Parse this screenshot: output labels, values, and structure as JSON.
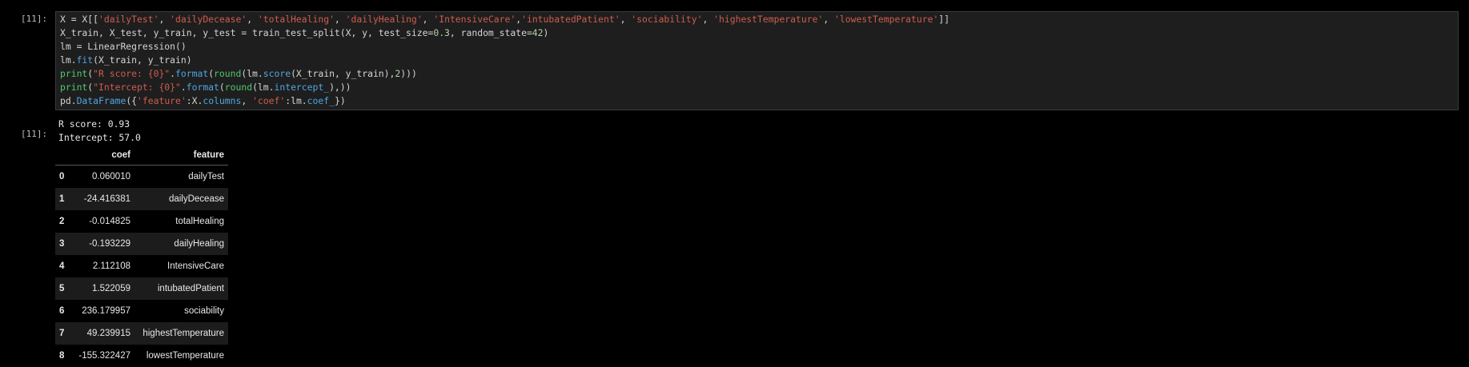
{
  "cell": {
    "in_prompt": "[11]:",
    "out_prompt": "[11]:",
    "code_lines": [
      [
        {
          "t": "X ",
          "c": "var"
        },
        {
          "t": "=",
          "c": "op"
        },
        {
          "t": " X[[",
          "c": "var"
        },
        {
          "t": "'dailyTest'",
          "c": "str"
        },
        {
          "t": ", ",
          "c": "var"
        },
        {
          "t": "'dailyDecease'",
          "c": "str"
        },
        {
          "t": ", ",
          "c": "var"
        },
        {
          "t": "'totalHealing'",
          "c": "str"
        },
        {
          "t": ", ",
          "c": "var"
        },
        {
          "t": "'dailyHealing'",
          "c": "str"
        },
        {
          "t": ", ",
          "c": "var"
        },
        {
          "t": "'IntensiveCare'",
          "c": "str"
        },
        {
          "t": ",",
          "c": "var"
        },
        {
          "t": "'intubatedPatient'",
          "c": "str"
        },
        {
          "t": ", ",
          "c": "var"
        },
        {
          "t": "'sociability'",
          "c": "str"
        },
        {
          "t": ", ",
          "c": "var"
        },
        {
          "t": "'highestTemperature'",
          "c": "str"
        },
        {
          "t": ", ",
          "c": "var"
        },
        {
          "t": "'lowestTemperature'",
          "c": "str"
        },
        {
          "t": "]]",
          "c": "var"
        }
      ],
      [
        {
          "t": "X_train, X_test, y_train, y_test ",
          "c": "var"
        },
        {
          "t": "=",
          "c": "op"
        },
        {
          "t": " train_test_split(X, y, test_size",
          "c": "var"
        },
        {
          "t": "=",
          "c": "op"
        },
        {
          "t": "0.3",
          "c": "num"
        },
        {
          "t": ", random_state",
          "c": "var"
        },
        {
          "t": "=",
          "c": "op"
        },
        {
          "t": "42",
          "c": "num"
        },
        {
          "t": ")",
          "c": "var"
        }
      ],
      [
        {
          "t": "lm ",
          "c": "var"
        },
        {
          "t": "=",
          "c": "op"
        },
        {
          "t": " LinearRegression()",
          "c": "var"
        }
      ],
      [
        {
          "t": "lm.",
          "c": "var"
        },
        {
          "t": "fit",
          "c": "fn"
        },
        {
          "t": "(X_train, y_train)",
          "c": "var"
        }
      ],
      [
        {
          "t": "print",
          "c": "bi"
        },
        {
          "t": "(",
          "c": "var"
        },
        {
          "t": "\"R score: {0}\"",
          "c": "str"
        },
        {
          "t": ".",
          "c": "var"
        },
        {
          "t": "format",
          "c": "fn"
        },
        {
          "t": "(",
          "c": "var"
        },
        {
          "t": "round",
          "c": "bi"
        },
        {
          "t": "(lm.",
          "c": "var"
        },
        {
          "t": "score",
          "c": "fn"
        },
        {
          "t": "(X_train, y_train),",
          "c": "var"
        },
        {
          "t": "2",
          "c": "num"
        },
        {
          "t": ")))",
          "c": "var"
        }
      ],
      [
        {
          "t": "print",
          "c": "bi"
        },
        {
          "t": "(",
          "c": "var"
        },
        {
          "t": "\"Intercept: {0}\"",
          "c": "str"
        },
        {
          "t": ".",
          "c": "var"
        },
        {
          "t": "format",
          "c": "fn"
        },
        {
          "t": "(",
          "c": "var"
        },
        {
          "t": "round",
          "c": "bi"
        },
        {
          "t": "(lm.",
          "c": "var"
        },
        {
          "t": "intercept_",
          "c": "fn"
        },
        {
          "t": "),))",
          "c": "var"
        }
      ],
      [
        {
          "t": "pd.",
          "c": "var"
        },
        {
          "t": "DataFrame",
          "c": "fn"
        },
        {
          "t": "({",
          "c": "var"
        },
        {
          "t": "'feature'",
          "c": "str"
        },
        {
          "t": ":X.",
          "c": "var"
        },
        {
          "t": "columns",
          "c": "fn"
        },
        {
          "t": ", ",
          "c": "var"
        },
        {
          "t": "'coef'",
          "c": "str"
        },
        {
          "t": ":lm.",
          "c": "var"
        },
        {
          "t": "coef_",
          "c": "fn"
        },
        {
          "t": "})",
          "c": "var"
        }
      ]
    ],
    "stdout": [
      "R score: 0.93",
      "Intercept: 57.0"
    ],
    "dataframe": {
      "columns": [
        "",
        "coef",
        "feature"
      ],
      "rows": [
        {
          "index": "0",
          "coef": "0.060010",
          "feature": "dailyTest"
        },
        {
          "index": "1",
          "coef": "-24.416381",
          "feature": "dailyDecease"
        },
        {
          "index": "2",
          "coef": "-0.014825",
          "feature": "totalHealing"
        },
        {
          "index": "3",
          "coef": "-0.193229",
          "feature": "dailyHealing"
        },
        {
          "index": "4",
          "coef": "2.112108",
          "feature": "IntensiveCare"
        },
        {
          "index": "5",
          "coef": "1.522059",
          "feature": "intubatedPatient"
        },
        {
          "index": "6",
          "coef": "236.179957",
          "feature": "sociability"
        },
        {
          "index": "7",
          "coef": "49.239915",
          "feature": "highestTemperature"
        },
        {
          "index": "8",
          "coef": "-155.322427",
          "feature": "lowestTemperature"
        }
      ]
    }
  }
}
